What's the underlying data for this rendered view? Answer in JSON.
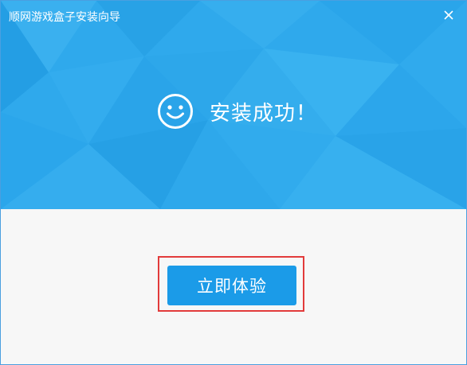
{
  "window": {
    "title": "顺网游戏盒子安装向导",
    "close_icon": "close-icon"
  },
  "banner": {
    "status_icon": "smiley-face-icon",
    "status_text": "安装成功！"
  },
  "actions": {
    "primary_label": "立即体验"
  },
  "colors": {
    "banner_blue": "#2fa9ec",
    "button_blue": "#1b9be8",
    "highlight_red": "#e23b3b",
    "body_bg": "#f7f7f7"
  }
}
